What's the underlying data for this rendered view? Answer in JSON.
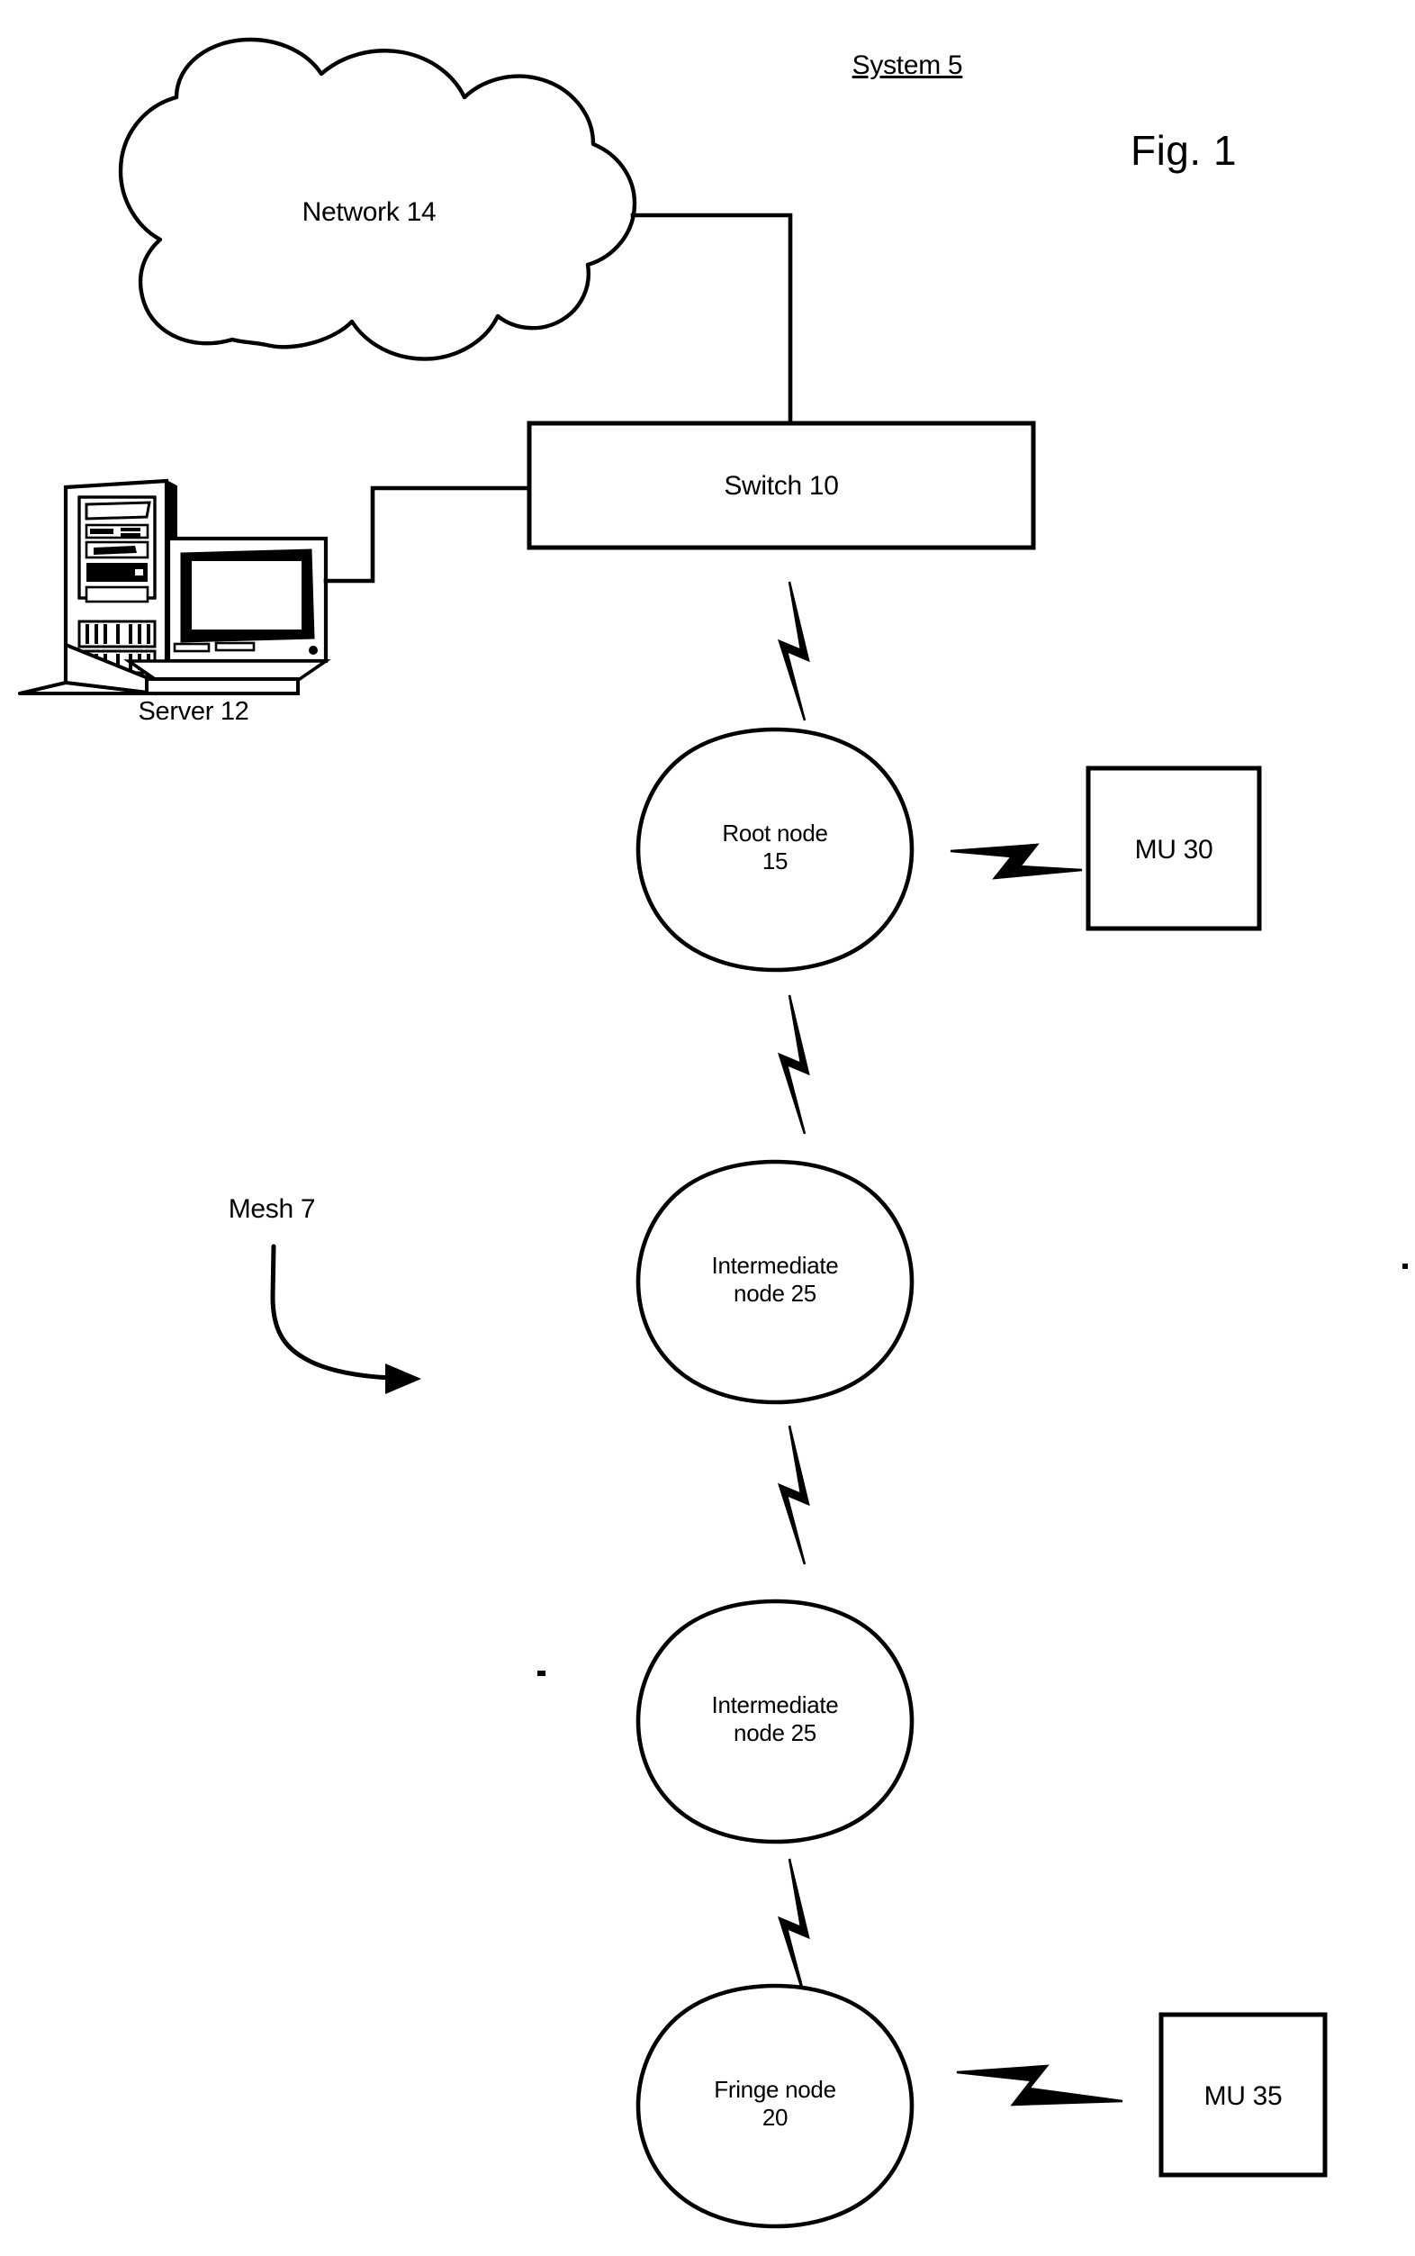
{
  "figure": {
    "title": "System 5",
    "number": "Fig. 1",
    "domain_note": "patent network mesh diagram"
  },
  "nodes": {
    "network": {
      "label": "Network 14",
      "shape": "cloud"
    },
    "switch": {
      "label": "Switch 10",
      "shape": "rectangle"
    },
    "server": {
      "label": "Server 12",
      "shape": "computer-illustration"
    },
    "root_node": {
      "line1": "Root node",
      "line2": "15",
      "shape": "circle"
    },
    "intermediate_node_1": {
      "line1": "Intermediate",
      "line2": "node 25",
      "shape": "circle"
    },
    "intermediate_node_2": {
      "line1": "Intermediate",
      "line2": "node 25",
      "shape": "circle"
    },
    "fringe_node": {
      "line1": "Fringe node",
      "line2": "20",
      "shape": "circle"
    },
    "mu30": {
      "label": "MU 30",
      "shape": "square"
    },
    "mu35": {
      "label": "MU 35",
      "shape": "square"
    }
  },
  "annotations": {
    "mesh": {
      "label": "Mesh 7",
      "pointer": "curved-arrow"
    }
  },
  "links": [
    {
      "from": "network",
      "to": "switch",
      "type": "wired"
    },
    {
      "from": "server",
      "to": "switch",
      "type": "wired"
    },
    {
      "from": "switch",
      "to": "root_node",
      "type": "wireless"
    },
    {
      "from": "root_node",
      "to": "mu30",
      "type": "wireless"
    },
    {
      "from": "root_node",
      "to": "intermediate_node_1",
      "type": "wireless"
    },
    {
      "from": "intermediate_node_1",
      "to": "intermediate_node_2",
      "type": "wireless"
    },
    {
      "from": "intermediate_node_2",
      "to": "fringe_node",
      "type": "wireless"
    },
    {
      "from": "fringe_node",
      "to": "mu35",
      "type": "wireless"
    }
  ],
  "colors": {
    "ink": "#000000",
    "paper": "#ffffff"
  }
}
